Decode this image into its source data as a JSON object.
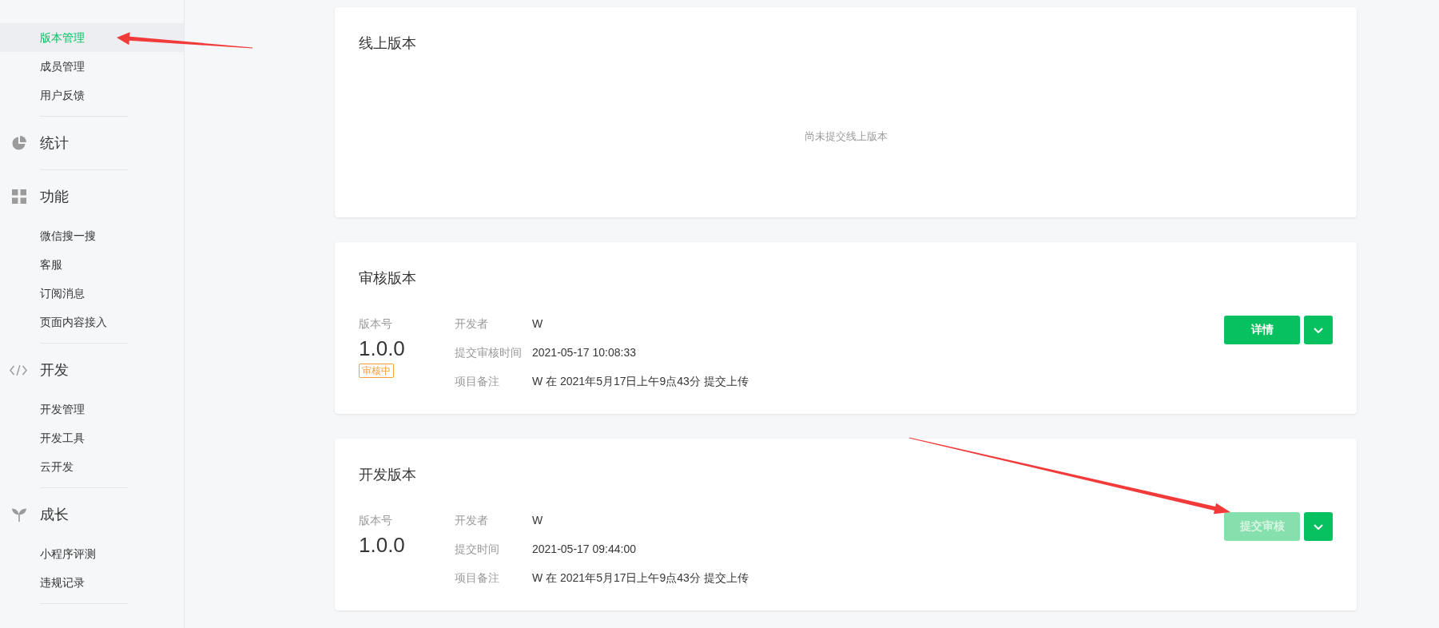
{
  "sidebar": {
    "sections": [
      {
        "items": [
          {
            "label": "版本管理",
            "selected": true,
            "annotated": true
          },
          {
            "label": "成员管理",
            "selected": false,
            "annotated": false
          },
          {
            "label": "用户反馈",
            "selected": false,
            "annotated": false
          }
        ]
      },
      {
        "title": "统计"
      },
      {
        "title": "功能",
        "items": [
          {
            "label": "微信搜一搜",
            "selected": false,
            "annotated": false
          },
          {
            "label": "客服",
            "selected": false,
            "annotated": false
          },
          {
            "label": "订阅消息",
            "selected": false,
            "annotated": false
          },
          {
            "label": "页面内容接入",
            "selected": false,
            "annotated": false
          }
        ]
      },
      {
        "title": "开发",
        "items": [
          {
            "label": "开发管理",
            "selected": false,
            "annotated": false
          },
          {
            "label": "开发工具",
            "selected": false,
            "annotated": false
          },
          {
            "label": "云开发",
            "selected": false,
            "annotated": false
          }
        ]
      },
      {
        "title": "成长",
        "items": [
          {
            "label": "小程序评测",
            "selected": false,
            "annotated": false
          },
          {
            "label": "违规记录",
            "selected": false,
            "annotated": false
          }
        ]
      }
    ]
  },
  "versions": [
    {
      "kind": "empty",
      "title": "线上版本",
      "empty_text": "尚未提交线上版本"
    },
    {
      "kind": "detail",
      "title": "审核版本",
      "version_label": "版本号",
      "version": "1.0.0",
      "badge": "审核中",
      "fields": [
        {
          "label": "开发者",
          "value": "W"
        },
        {
          "label": "提交审核时间",
          "value": "2021-05-17 10:08:33"
        },
        {
          "label": "项目备注",
          "value": "W 在 2021年5月17日上午9点43分 提交上传"
        }
      ],
      "primary_button": {
        "label": "详情",
        "disabled": false,
        "annotated": false
      }
    },
    {
      "kind": "detail",
      "title": "开发版本",
      "version_label": "版本号",
      "version": "1.0.0",
      "fields": [
        {
          "label": "开发者",
          "value": "W"
        },
        {
          "label": "提交时间",
          "value": "2021-05-17 09:44:00"
        },
        {
          "label": "项目备注",
          "value": "W 在 2021年5月17日上午9点43分 提交上传"
        }
      ],
      "primary_button": {
        "label": "提交审核",
        "disabled": true,
        "annotated": true
      }
    }
  ]
}
